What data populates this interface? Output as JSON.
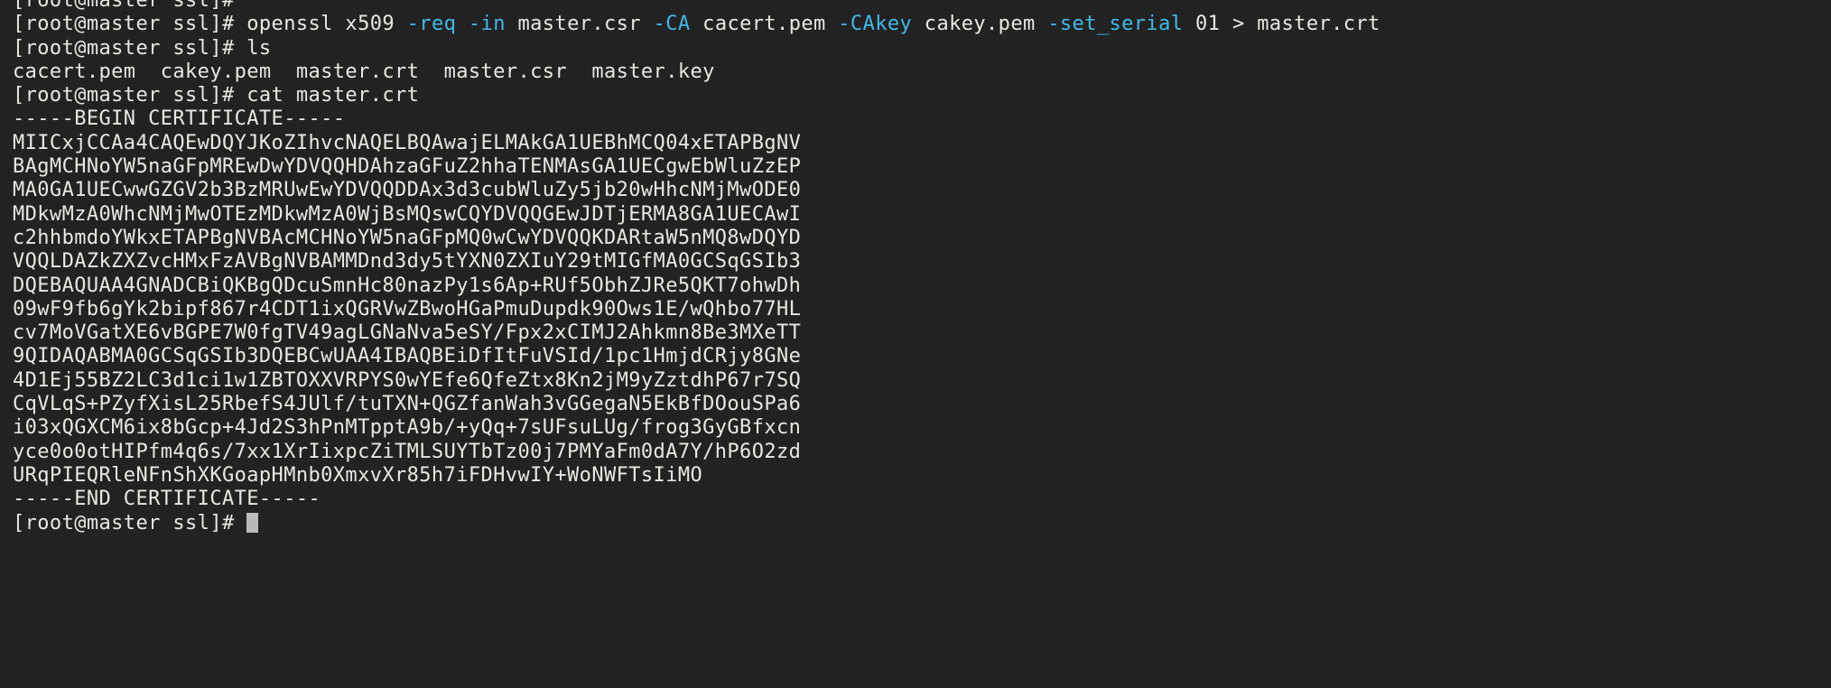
{
  "terminal": {
    "background_color": "#222222",
    "foreground_color": "#e8e8e2",
    "accent_color": "#44b8e8",
    "cursor_color": "#b9b9b9",
    "prompt": "[root@master ssl]# ",
    "lines": [
      {
        "id": "line-0-partial-prompt",
        "kind": "prompt",
        "segments": [
          {
            "text": "[root@master ssl]# ",
            "color": "default"
          }
        ]
      },
      {
        "id": "line-1-openssl-command",
        "kind": "command",
        "segments": [
          {
            "text": "[root@master ssl]# openssl x509 ",
            "color": "default"
          },
          {
            "text": "-req",
            "color": "cyan"
          },
          {
            "text": " ",
            "color": "default"
          },
          {
            "text": "-in",
            "color": "cyan"
          },
          {
            "text": " master.csr ",
            "color": "default"
          },
          {
            "text": "-CA",
            "color": "cyan"
          },
          {
            "text": " cacert.pem ",
            "color": "default"
          },
          {
            "text": "-CAkey",
            "color": "cyan"
          },
          {
            "text": " cakey.pem ",
            "color": "default"
          },
          {
            "text": "-set_serial",
            "color": "cyan"
          },
          {
            "text": " 01 > master.crt",
            "color": "default"
          }
        ]
      },
      {
        "id": "line-2-ls-command",
        "kind": "command",
        "segments": [
          {
            "text": "[root@master ssl]# ls",
            "color": "default"
          }
        ]
      },
      {
        "id": "line-3-ls-output",
        "kind": "output",
        "segments": [
          {
            "text": "cacert.pem  cakey.pem  master.crt  master.csr  master.key",
            "color": "default"
          }
        ]
      },
      {
        "id": "line-4-cat-command",
        "kind": "command",
        "segments": [
          {
            "text": "[root@master ssl]# cat master.crt",
            "color": "default"
          }
        ]
      },
      {
        "id": "line-5-begin-certificate",
        "kind": "output",
        "segments": [
          {
            "text": "-----BEGIN CERTIFICATE-----",
            "color": "default"
          }
        ]
      },
      {
        "id": "line-6-b64",
        "kind": "output",
        "segments": [
          {
            "text": "MIICxjCCAa4CAQEwDQYJKoZIhvcNAQELBQAwajELMAkGA1UEBhMCQ04xETAPBgNV",
            "color": "default"
          }
        ]
      },
      {
        "id": "line-7-b64",
        "kind": "output",
        "segments": [
          {
            "text": "BAgMCHNoYW5naGFpMREwDwYDVQQHDAhzaGFuZ2hhaTENMAsGA1UECgwEbWluZzEP",
            "color": "default"
          }
        ]
      },
      {
        "id": "line-8-b64",
        "kind": "output",
        "segments": [
          {
            "text": "MA0GA1UECwwGZGV2b3BzMRUwEwYDVQQDDAx3d3cubWluZy5jb20wHhcNMjMwODE0",
            "color": "default"
          }
        ]
      },
      {
        "id": "line-9-b64",
        "kind": "output",
        "segments": [
          {
            "text": "MDkwMzA0WhcNMjMwOTEzMDkwMzA0WjBsMQswCQYDVQQGEwJDTjERMA8GA1UECAwI",
            "color": "default"
          }
        ]
      },
      {
        "id": "line-10-b64",
        "kind": "output",
        "segments": [
          {
            "text": "c2hhbmdoYWkxETAPBgNVBAcMCHNoYW5naGFpMQ0wCwYDVQQKDARtaW5nMQ8wDQYD",
            "color": "default"
          }
        ]
      },
      {
        "id": "line-11-b64",
        "kind": "output",
        "segments": [
          {
            "text": "VQQLDAZkZXZvcHMxFzAVBgNVBAMMDnd3dy5tYXN0ZXIuY29tMIGfMA0GCSqGSIb3",
            "color": "default"
          }
        ]
      },
      {
        "id": "line-12-b64",
        "kind": "output",
        "segments": [
          {
            "text": "DQEBAQUAA4GNADCBiQKBgQDcuSmnHc80nazPy1s6Ap+RUf5ObhZJRe5QKT7ohwDh",
            "color": "default"
          }
        ]
      },
      {
        "id": "line-13-b64",
        "kind": "output",
        "segments": [
          {
            "text": "09wF9fb6gYk2bipf867r4CDT1ixQGRVwZBwoHGaPmuDupdk90Ows1E/wQhbo77HL",
            "color": "default"
          }
        ]
      },
      {
        "id": "line-14-b64",
        "kind": "output",
        "segments": [
          {
            "text": "cv7MoVGatXE6vBGPE7W0fgTV49agLGNaNva5eSY/Fpx2xCIMJ2Ahkmn8Be3MXeTT",
            "color": "default"
          }
        ]
      },
      {
        "id": "line-15-b64",
        "kind": "output",
        "segments": [
          {
            "text": "9QIDAQABMA0GCSqGSIb3DQEBCwUAA4IBAQBEiDfItFuVSId/1pc1HmjdCRjy8GNe",
            "color": "default"
          }
        ]
      },
      {
        "id": "line-16-b64",
        "kind": "output",
        "segments": [
          {
            "text": "4D1Ej55BZ2LC3d1ci1w1ZBTOXXVRPYS0wYEfe6QfeZtx8Kn2jM9yZztdhP67r7SQ",
            "color": "default"
          }
        ]
      },
      {
        "id": "line-17-b64",
        "kind": "output",
        "segments": [
          {
            "text": "CqVLqS+PZyfXisL25RbefS4JUlf/tuTXN+QGZfanWah3vGGegaN5EkBfDOouSPa6",
            "color": "default"
          }
        ]
      },
      {
        "id": "line-18-b64",
        "kind": "output",
        "segments": [
          {
            "text": "i03xQGXCM6ix8bGcp+4Jd2S3hPnMTpptA9b/+yQq+7sUFsuLUg/frog3GyGBfxcn",
            "color": "default"
          }
        ]
      },
      {
        "id": "line-19-b64",
        "kind": "output",
        "segments": [
          {
            "text": "yce0o0otHIPfm4q6s/7xx1XrIixpcZiTMLSUYTbTz00j7PMYaFm0dA7Y/hP6O2zd",
            "color": "default"
          }
        ]
      },
      {
        "id": "line-20-b64",
        "kind": "output",
        "segments": [
          {
            "text": "URqPIEQRleNFnShXKGoapHMnb0XmxvXr85h7iFDHvwIY+WoNWFTsIiMO",
            "color": "default"
          }
        ]
      },
      {
        "id": "line-21-end-certificate",
        "kind": "output",
        "segments": [
          {
            "text": "-----END CERTIFICATE-----",
            "color": "default"
          }
        ]
      },
      {
        "id": "line-22-final-prompt",
        "kind": "prompt",
        "segments": [
          {
            "text": "[root@master ssl]# ",
            "color": "default"
          }
        ],
        "cursor": true
      }
    ]
  }
}
